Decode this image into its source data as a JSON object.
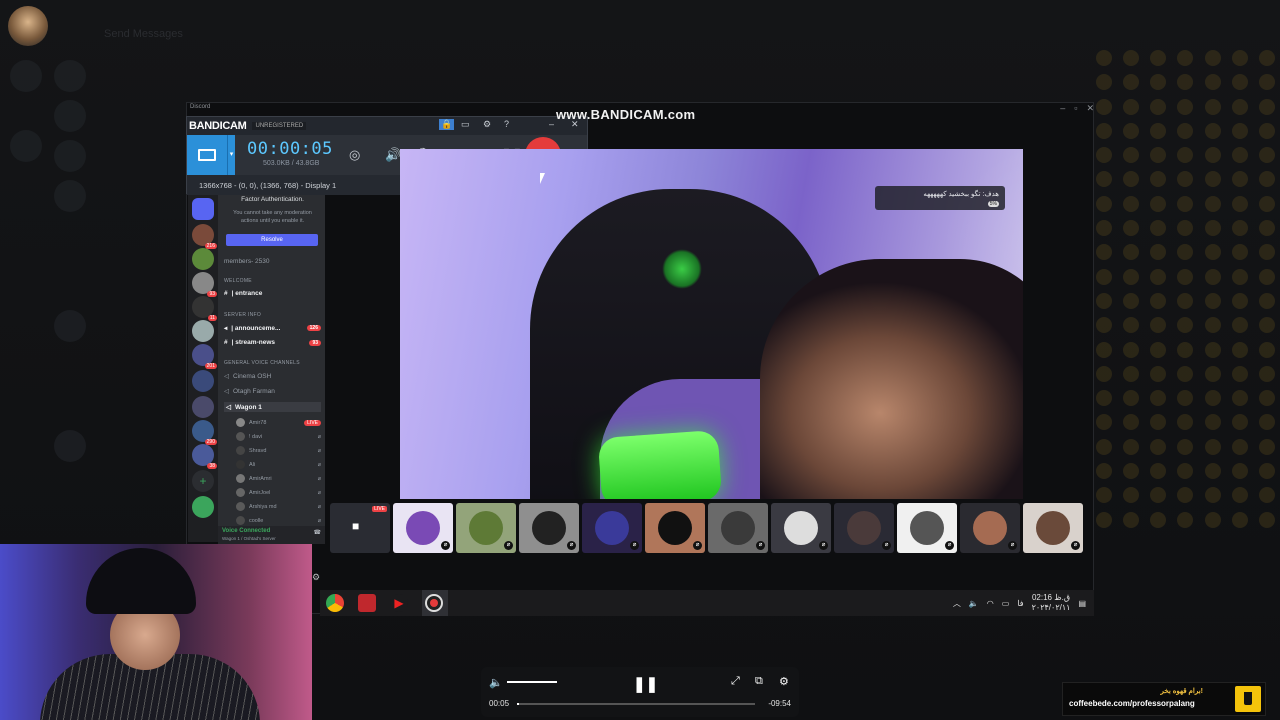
{
  "background": {
    "header_text": "Send Messages"
  },
  "bandicam": {
    "watermark": "www.BANDICAM.com",
    "logo": "BANDICAM",
    "unregistered": "UNREGISTERED",
    "timer": "00:00:05",
    "size": "503.0KB / 43.8GB",
    "display_info": "1366x768 - (0, 0), (1366, 768) - Display 1"
  },
  "discord": {
    "window_title": "Discord",
    "notice_line1": "Factor Authentication.",
    "notice_line2": "You cannot take any moderation",
    "notice_line3": "actions until you enable it.",
    "resolve_label": "Resolve",
    "members": "members- 2530",
    "categories": {
      "welcome": "WELCOME",
      "server_info": "SERVER INFO",
      "voice": "GENERAL VOICE CHANNELS"
    },
    "channels": {
      "entrance": "| entrance",
      "announcements": "| announceme...",
      "announcements_badge": "126",
      "stream_news": "| stream-news",
      "stream_news_badge": "93",
      "cinema": "Cinema OSH",
      "otagh": "Otagh Farman",
      "wagon": "Wagon 1"
    },
    "voice_users": [
      "Amir78",
      "! davi",
      "Shravd",
      "Ali",
      "AmirAmri",
      "AmirJoel",
      "Arshiya md",
      "coolle"
    ],
    "live_label": "LIVE",
    "voice_connected": "Voice Connected",
    "voice_location": "Wagon 1 / Oshtad's Server",
    "server_badges": [
      "216",
      "93",
      "11",
      "201",
      "290",
      "38"
    ]
  },
  "stream": {
    "goal_text": "هدف: تگو ببخشید کهههههه",
    "goal_percent": "5%"
  },
  "thumbs_live_label": "LIVE",
  "taskbar": {
    "time": "02:16 ق.ظ",
    "date": "۲۰۲۴/۰۲/۱۱",
    "lang": "فا"
  },
  "player": {
    "current": "00:05",
    "remaining": "-09:54",
    "progress": 0.01,
    "volume": 0.75
  },
  "coffee": {
    "title": "برام قهوه بخر!",
    "url": "coffeebede.com/professorpalang"
  },
  "colors": {
    "discord_blurple": "#5865f2",
    "bandicam_blue": "#2b90d9",
    "rec_red": "#e43b3b",
    "timer_cyan": "#5cc8ff"
  }
}
